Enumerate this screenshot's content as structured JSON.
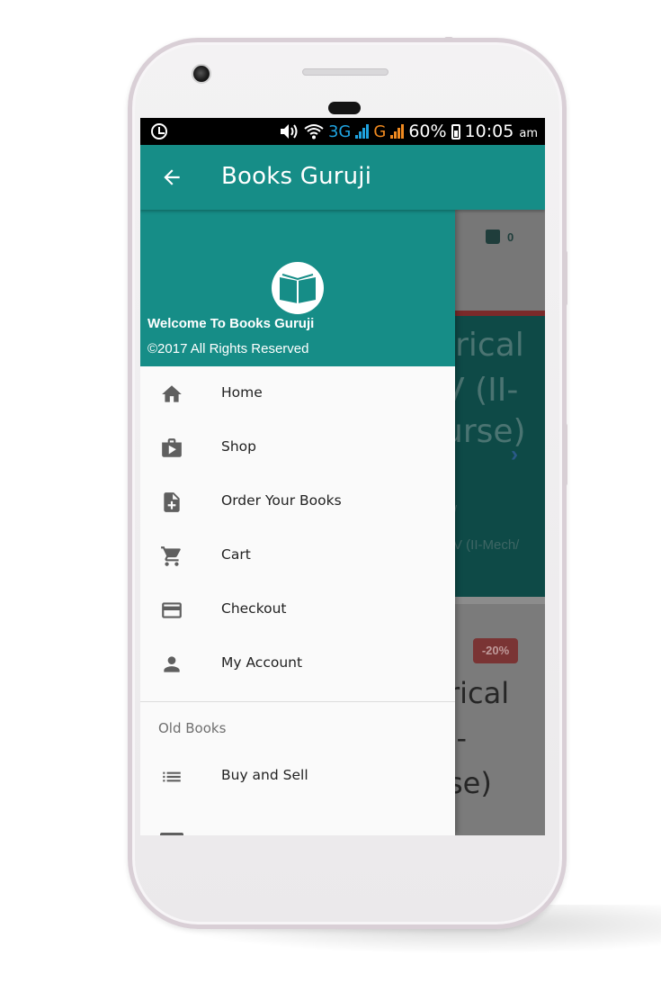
{
  "status_bar": {
    "network_3g": "3G",
    "network_g": "G",
    "battery": "60%",
    "time": "10:05",
    "ampm": "am"
  },
  "app_bar": {
    "title": "Books Guruji",
    "back_icon": "arrow-back-icon"
  },
  "drawer": {
    "header": {
      "welcome": "Welcome To Books Guruji",
      "copyright": "©2017 All Rights Reserved",
      "logo_icon": "open-book-icon"
    },
    "items": [
      {
        "label": "Home",
        "icon": "home-icon"
      },
      {
        "label": "Shop",
        "icon": "shop-bag-icon"
      },
      {
        "label": "Order Your Books",
        "icon": "note-add-icon"
      },
      {
        "label": "Cart",
        "icon": "cart-icon"
      },
      {
        "label": "Checkout",
        "icon": "credit-card-icon"
      },
      {
        "label": "My Account",
        "icon": "person-icon"
      }
    ],
    "section_title": "Old Books",
    "section_items": [
      {
        "label": "Buy and Sell",
        "icon": "list-icon"
      }
    ]
  },
  "background_page": {
    "cart_count": "0",
    "banner_lines": [
      "trical",
      "V (II-",
      "urse)"
    ],
    "banner_small": [
      "/",
      "V (II-Mech/"
    ],
    "discount_badge": "-20%",
    "product_lines": [
      "rical",
      "I-",
      "se)"
    ]
  },
  "colors": {
    "primary": "#168d87",
    "statusbar": "#000000",
    "drawer_bg": "#fafafa",
    "icon_gray": "#5f5f5f"
  }
}
